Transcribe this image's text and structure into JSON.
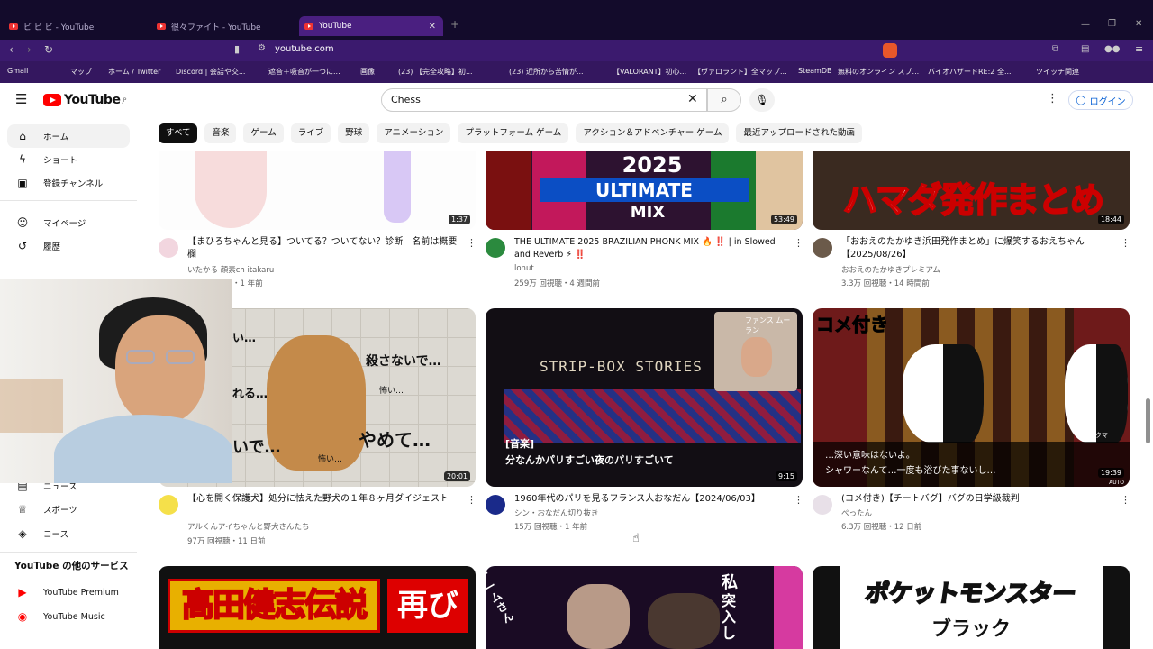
{
  "browser": {
    "tabs": [
      {
        "label": "ビ ビ ビ - YouTube"
      },
      {
        "label": "很々ファイト - YouTube"
      },
      {
        "label": "YouTube",
        "active": true
      }
    ],
    "url": "youtube.com",
    "bookmarks": [
      "Gmail",
      "マップ",
      "ホーム / Twitter",
      "Discord | 会話や交...",
      "遮音＋吸音が一つに...",
      "画像",
      "(23) 【完全攻略】初...",
      "(23) 近所から苦情が...",
      "【VALORANT】初心...",
      "【ヴァロラント】全マップ...",
      "SteamDB",
      "無料のオンライン スプ...",
      "バイオハザードRE:2 全...",
      "ツイッチ関連"
    ]
  },
  "masthead": {
    "logo": "YouTube",
    "region": "JP",
    "search_value": "Chess",
    "login_label": "ログイン"
  },
  "chips": [
    "すべて",
    "音楽",
    "ゲーム",
    "ライブ",
    "野球",
    "アニメーション",
    "プラットフォーム ゲーム",
    "アクション＆アドベンチャー ゲーム",
    "最近アップロードされた動画"
  ],
  "sidebar": {
    "items": [
      {
        "label": "ホーム"
      },
      {
        "label": "ショート"
      },
      {
        "label": "登録チャンネル"
      },
      {
        "label": "マイページ"
      },
      {
        "label": "履歴"
      },
      {
        "label": "ニュース"
      },
      {
        "label": "スポーツ"
      },
      {
        "label": "コース"
      }
    ],
    "more_heading": "YouTube の他のサービス",
    "services": [
      {
        "label": "YouTube Premium"
      },
      {
        "label": "YouTube Music"
      }
    ]
  },
  "videos": [
    {
      "title": "【まひろちゃんと見る】ついてる？ついてない？診断　名前は概要欄",
      "channel": "いたかる 顔素ch itakaru",
      "meta": "・1 年前",
      "duration": "1:37"
    },
    {
      "title": "THE ULTIMATE 2025 BRAZILIAN PHONK MIX 🔥 ‼️ | in Slowed and Reverb ⚡ ‼️",
      "channel": "lonut",
      "meta": "259万 回視聴・4 週間前",
      "duration": "53:49",
      "thumb_year": "2025",
      "thumb_word1": "ULTIMATE",
      "thumb_word2": "MIX"
    },
    {
      "title": "「おおえのたかゆき浜田発作まとめ」に爆笑するおえちゃん【2025/08/26】",
      "channel": "おおえのたかゆきプレミアム",
      "meta": "3.3万 回視聴・14 時間前",
      "duration": "18:44",
      "thumb_text": "ハマダ発作まとめ"
    },
    {
      "title": "【心を開く保護犬】処分に怯えた野犬の１年８ヶ月ダイジェスト",
      "channel": "アルくんアイちゃんと野犬さんたち",
      "meta": "97万 回視聴・11 日前",
      "duration": "20:01",
      "thumb_t1": "殺さないで…",
      "thumb_t2": "やめて…",
      "thumb_t3": "怖い…",
      "thumb_t4": "れる…",
      "thumb_t5": "いで…",
      "thumb_t6": "怖い…",
      "thumb_t7": "い…"
    },
    {
      "title": "1960年代のパリを見るフランス人おなだん【2024/06/03】",
      "channel": "シン・おなだん切り抜き",
      "meta": "15万 回視聴・1 年前",
      "duration": "9:15",
      "thumb_sign": "STRIP-BOX STORIES",
      "thumb_tag": "[音楽]",
      "thumb_caption": "分なんかパリすごい夜のパリすごいて",
      "pip_label": "ファンス ムーラン"
    },
    {
      "title": "(コメ付き)【チートバグ】バグの日学級裁判",
      "channel": "ぺったん",
      "meta": "6.3万 回視聴・12 日前",
      "duration": "19:39",
      "thumb_tag": "コメ付き",
      "thumb_caption1": "…深い意味はないよ。",
      "thumb_caption2": "シャワーなんて…一度も浴びた事ないし…",
      "thumb_name": "モノクマ",
      "thumb_auto": "AUTO"
    },
    {
      "thumb_text": "高田健志伝説",
      "thumb_badge": "再び"
    },
    {
      "thumb_vert": "ゲームさん",
      "thumb_v2": "私",
      "thumb_v3": "突入し"
    },
    {
      "thumb_text": "ポケットモンスター",
      "thumb_sub": "ブラック"
    }
  ],
  "colors": {
    "browser_tab": "#130b2b",
    "browser_toolbar": "#3b1a6e",
    "yt_red": "#ff0000",
    "link_blue": "#065fd4"
  }
}
